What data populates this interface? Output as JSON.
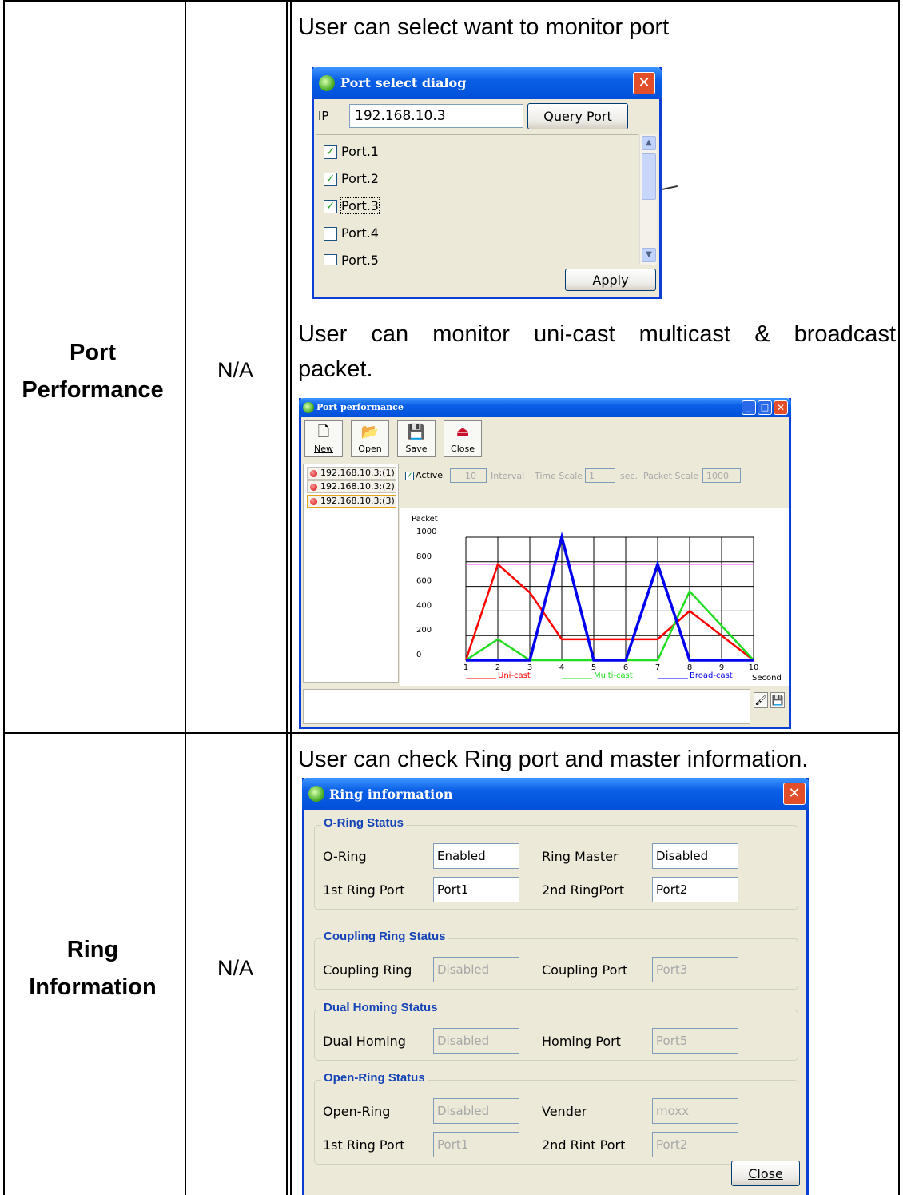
{
  "rows": [
    {
      "title_line1": "Port",
      "title_line2": "Performance",
      "default": "N/A",
      "desc1": "User can select want to monitor port",
      "desc2_line1": "User can monitor uni-cast multicast & broadcast",
      "desc2_line2": "packet."
    },
    {
      "title_line1": "Ring",
      "title_line2": "Information",
      "default": "N/A",
      "desc1": "User can check Ring port and master information."
    }
  ],
  "port_select_dialog": {
    "title": "Port select dialog",
    "ip_label": "IP",
    "ip_value": "192.168.10.3",
    "query_button": "Query Port",
    "ports": [
      {
        "label": "Port.1",
        "checked": true
      },
      {
        "label": "Port.2",
        "checked": true
      },
      {
        "label": "Port.3",
        "checked": true
      },
      {
        "label": "Port.4",
        "checked": false
      },
      {
        "label": "Port.5",
        "checked": false
      }
    ],
    "apply_button": "Apply"
  },
  "port_performance": {
    "title": "Port performance",
    "toolbar": [
      "New",
      "Open",
      "Save",
      "Close"
    ],
    "tree": [
      "192.168.10.3:(1)",
      "192.168.10.3:(2)",
      "192.168.10.3:(3)"
    ],
    "active_label": "Active",
    "interval_value": "10",
    "interval_label": "Interval",
    "time_scale_label": "Time Scale",
    "time_scale_value": "1",
    "sec_label": "sec.",
    "packet_scale_label": "Packet Scale",
    "packet_scale_value": "1000"
  },
  "chart_data": {
    "type": "line",
    "ylabel": "Packet",
    "xlabel": "Second",
    "x": [
      1,
      2,
      3,
      4,
      5,
      6,
      7,
      8,
      9,
      10
    ],
    "ylim": [
      0,
      1000
    ],
    "yticks": [
      0,
      200,
      400,
      600,
      800,
      1000
    ],
    "grid": true,
    "reference_line": {
      "value": 780,
      "color": "#ee66ee"
    },
    "series": [
      {
        "name": "Uni-cast",
        "color": "#ff0000",
        "values": [
          0,
          780,
          550,
          170,
          170,
          170,
          170,
          400,
          200,
          0
        ]
      },
      {
        "name": "Multi-cast",
        "color": "#22dd22",
        "values": [
          0,
          170,
          0,
          0,
          0,
          0,
          0,
          560,
          280,
          0
        ]
      },
      {
        "name": "Broad-cast",
        "color": "#0000ee",
        "values": [
          0,
          0,
          0,
          1000,
          0,
          0,
          780,
          0,
          0,
          0
        ]
      }
    ]
  },
  "ring_information": {
    "title": "Ring information",
    "groups": [
      {
        "title": "O-Ring Status",
        "rows": [
          {
            "l1": "O-Ring",
            "v1": "Enabled",
            "l2": "Ring Master",
            "v2": "Disabled",
            "disabled": false
          },
          {
            "l1": "1st Ring Port",
            "v1": "Port1",
            "l2": "2nd RingPort",
            "v2": "Port2",
            "disabled": false
          }
        ]
      },
      {
        "title": "Coupling Ring Status",
        "rows": [
          {
            "l1": "Coupling Ring",
            "v1": "Disabled",
            "l2": "Coupling Port",
            "v2": "Port3",
            "disabled": true
          }
        ]
      },
      {
        "title": "Dual Homing Status",
        "rows": [
          {
            "l1": "Dual Homing",
            "v1": "Disabled",
            "l2": "Homing Port",
            "v2": "Port5",
            "disabled": true
          }
        ]
      },
      {
        "title": "Open-Ring Status",
        "rows": [
          {
            "l1": "Open-Ring",
            "v1": "Disabled",
            "l2": "Vender",
            "v2": "moxx",
            "disabled": true
          },
          {
            "l1": "1st Ring Port",
            "v1": "Port1",
            "l2": "2nd Rint Port",
            "v2": "Port2",
            "disabled": true
          }
        ]
      }
    ],
    "close_button": "Close"
  }
}
